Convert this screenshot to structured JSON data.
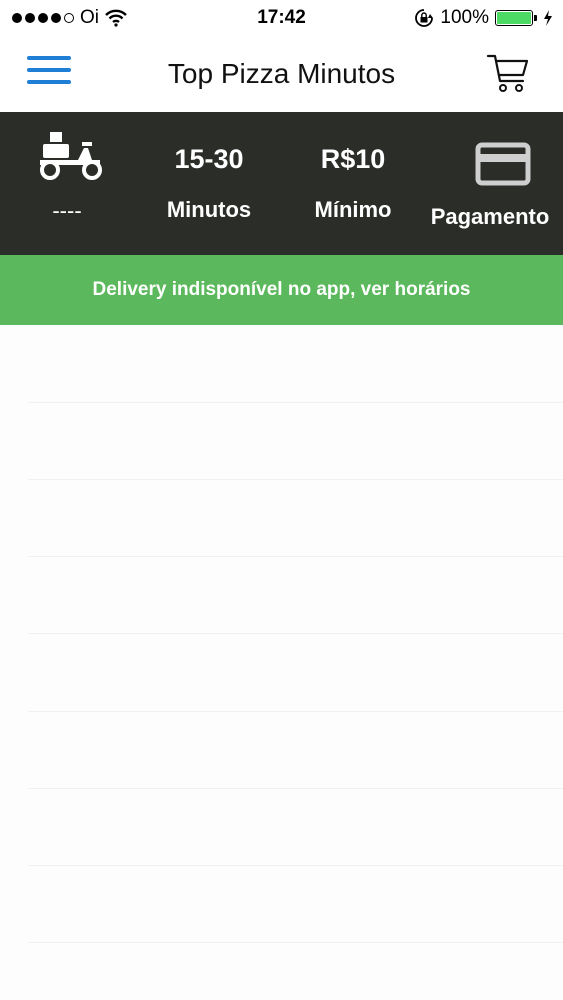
{
  "status_bar": {
    "carrier": "Oi",
    "time": "17:42",
    "battery": "100%"
  },
  "nav": {
    "title": "Top Pizza Minutos",
    "menu_icon": "hamburger-icon",
    "cart_icon": "cart-icon"
  },
  "info": {
    "delivery_fee": "----",
    "time_value": "15-30",
    "time_label": "Minutos",
    "min_value": "R$10",
    "min_label": "Mínimo",
    "payment_label": "Pagamento"
  },
  "banner": {
    "text": "Delivery indisponível no app, ver horários"
  },
  "colors": {
    "accent_blue": "#1f7fd6",
    "info_bar_bg": "#2b2e28",
    "banner_green": "#5cb85c",
    "battery_green": "#4cd964"
  }
}
